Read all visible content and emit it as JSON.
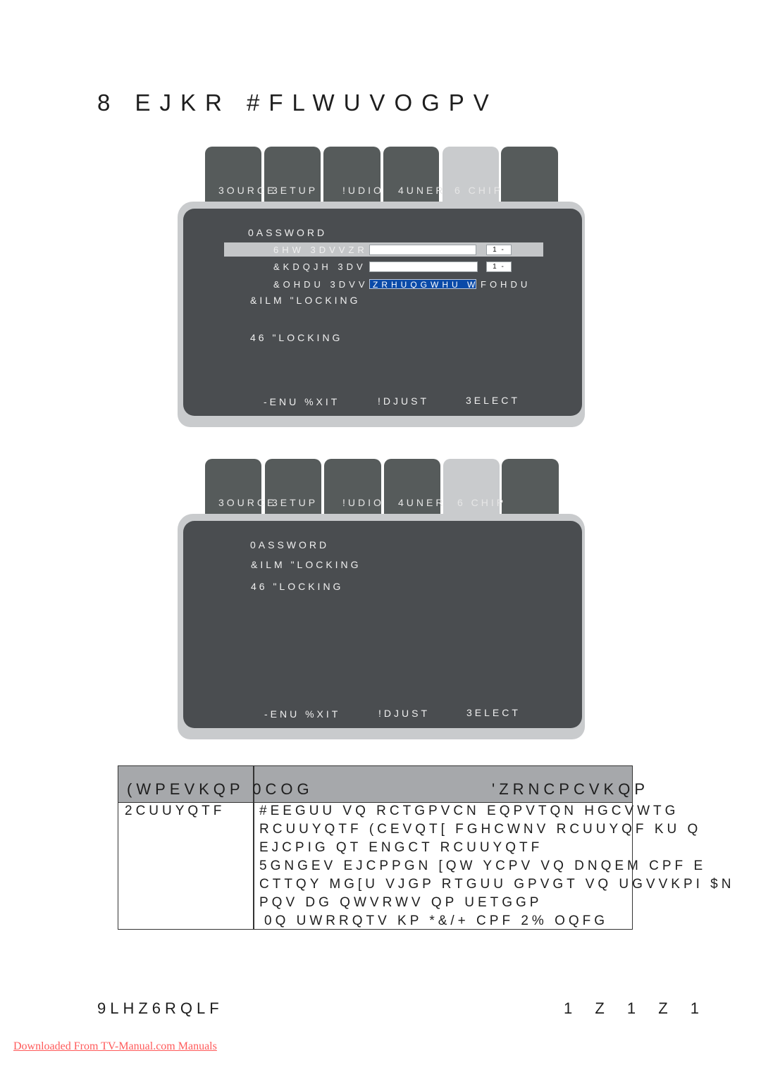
{
  "page": {
    "title": "8 EJKR #FLWUVOGPV",
    "footer_left": "9LHZ6RQLF",
    "footer_right": "1  Z 1  Z 1",
    "download_link": "Downloaded From TV-Manual.com Manuals"
  },
  "osd_menus": [
    {
      "tabs": [
        {
          "label": "3OURCE"
        },
        {
          "label": "3ETUP"
        },
        {
          "label": "!UDIO"
        },
        {
          "label": "4UNER"
        },
        {
          "label": "6 CHIP",
          "active": true
        },
        {
          "label": ""
        }
      ],
      "items": [
        {
          "label": "0ASSWORD"
        },
        {
          "label": "&ILM \"LOCKING"
        },
        {
          "label": "46 \"LOCKING"
        }
      ],
      "submenu": [
        {
          "label": "6HW 3DVVZR",
          "value": "",
          "chip": "1 -",
          "highlighted": true
        },
        {
          "label": "&KDQJH 3DV",
          "value": "",
          "chip": "1 -"
        },
        {
          "label": "&OHDU 3DVV",
          "value": "ZRHUQGWHU WR",
          "suffix": "FOHDU"
        }
      ],
      "hints": [
        "-ENU %XIT",
        "!DJUST",
        "3ELECT"
      ]
    },
    {
      "tabs": [
        {
          "label": "3OURCE"
        },
        {
          "label": "3ETUP"
        },
        {
          "label": "!UDIO"
        },
        {
          "label": "4UNER"
        },
        {
          "label": "6 CHIP",
          "active": true
        },
        {
          "label": ""
        }
      ],
      "items": [
        {
          "label": "0ASSWORD"
        },
        {
          "label": "&ILM \"LOCKING"
        },
        {
          "label": "46 \"LOCKING"
        }
      ],
      "hints": [
        "-ENU %XIT",
        "!DJUST",
        "3ELECT"
      ]
    }
  ],
  "table": {
    "headers": [
      "(WPEVKQP 0COG",
      "'ZRNCPCVKQP"
    ],
    "rows": [
      {
        "name": "2CUUYQTF",
        "description": [
          "#EEGUU VQ RCTGPVCN EQPVTQN HGCVWTG",
          "RCUUYQTF (CEVQT[ FGHCWNV RCUUYQF KU Q",
          "EJCPIG QT ENGCT RCUUYQTF",
          "5GNGEV EJCPPGN [QW YCPV VQ DNQEM CPF E",
          "CTTQY MG[U VJGP RTGUU GPVGT VQ UGVVKPI $N",
          "PQV DG QWVRWV QP UETGGP",
          "0Q UWRRQTV KP *&/+ CPF 2% OQFG"
        ]
      }
    ]
  }
}
